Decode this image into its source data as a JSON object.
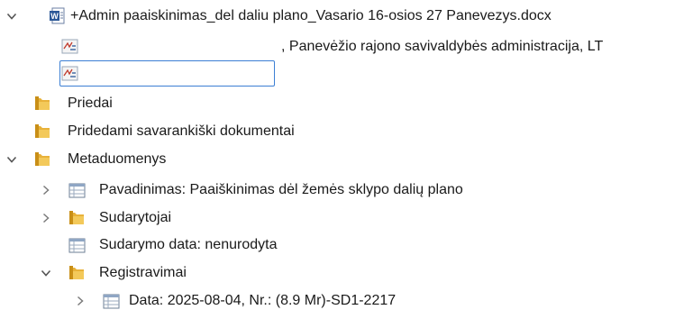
{
  "tree": {
    "root": {
      "label": "+Admin paaiskinimas_del daliu plano_Vasario 16-osios 27 Panevezys.docx",
      "icon": "word-document-icon",
      "expanded": true
    },
    "signer1": {
      "label": ", Panevėžio rajono savivaldybės administracija, LT",
      "icon": "signature-icon"
    },
    "signer2": {
      "label": "",
      "icon": "signature-icon",
      "editing": true
    },
    "priedai": {
      "label": "Priedai",
      "icon": "folder-icon"
    },
    "pridedami": {
      "label": "Pridedami savarankiški dokumentai",
      "icon": "folder-icon"
    },
    "metaduomenys": {
      "label": "Metaduomenys",
      "icon": "folder-icon",
      "expanded": true
    },
    "pavadinimas": {
      "label": "Pavadinimas: Paaiškinimas dėl žemės sklypo dalių plano",
      "icon": "table-icon",
      "expanded": false
    },
    "sudarytojai": {
      "label": "Sudarytojai",
      "icon": "folder-icon",
      "expanded": false
    },
    "sudarymo_data": {
      "label": "Sudarymo data: nenurodyta",
      "icon": "table-icon"
    },
    "registravimai": {
      "label": "Registravimai",
      "icon": "folder-icon",
      "expanded": true
    },
    "data_row": {
      "label": "Data: 2025-08-04, Nr.: (8.9 Mr)-SD1-2217",
      "icon": "table-icon",
      "expanded": false
    }
  },
  "colors": {
    "folder": "#e8b23a",
    "folder_dark": "#c98f17",
    "word_blue": "#2b5797",
    "selection_border": "#3c7fd4",
    "chevron": "#7a7a7a"
  }
}
